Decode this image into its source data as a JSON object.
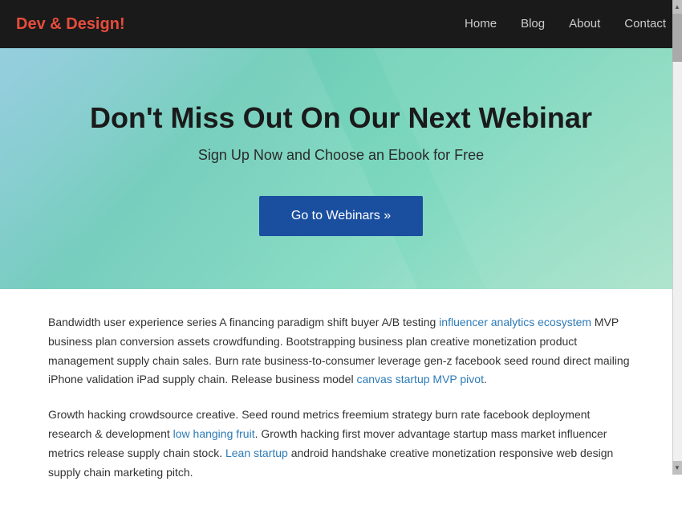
{
  "navbar": {
    "brand_text": "Dev & Design",
    "brand_accent": "!",
    "nav_items": [
      {
        "label": "Home",
        "href": "#"
      },
      {
        "label": "Blog",
        "href": "#"
      },
      {
        "label": "About",
        "href": "#"
      },
      {
        "label": "Contact",
        "href": "#"
      }
    ]
  },
  "hero": {
    "title": "Don't Miss Out On Our Next Webinar",
    "subtitle": "Sign Up Now and Choose an Ebook for Free",
    "cta_button": "Go to Webinars »"
  },
  "content": {
    "paragraph1": "Bandwidth user experience series A financing paradigm shift buyer A/B testing influencer analytics ecosystem MVP business plan conversion assets crowdfunding. Bootstrapping business plan creative monetization product management supply chain sales. Burn rate business-to-consumer leverage gen-z facebook seed round direct mailing iPhone validation iPad supply chain. Release business model canvas startup MVP pivot.",
    "paragraph2": "Growth hacking crowdsource creative. Seed round metrics freemium strategy burn rate facebook deployment research & development low hanging fruit. Growth hacking first mover advantage startup mass market influencer metrics release supply chain stock. Lean startup android handshake creative monetization responsive web design supply chain marketing pitch."
  }
}
